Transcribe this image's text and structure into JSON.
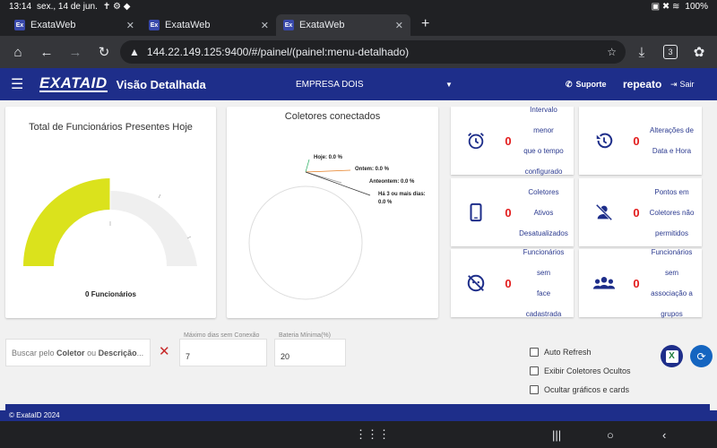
{
  "status_bar": {
    "time": "13:14",
    "date": "sex., 14 de jun.",
    "battery": "100%"
  },
  "browser": {
    "tabs": [
      {
        "label": "ExataWeb",
        "favicon": "Ex"
      },
      {
        "label": "ExataWeb",
        "favicon": "Ex"
      },
      {
        "label": "ExataWeb",
        "favicon": "Ex"
      }
    ],
    "url": "144.22.149.125:9400/#/painel/(painel:menu-detalhado)",
    "tab_count": "3"
  },
  "app": {
    "logo": "EXATAID",
    "title": "Visão Detalhada",
    "company": "EMPRESA DOIS",
    "support_label": "Suporte",
    "user": "repeato",
    "logout_label": "Sair"
  },
  "gauge_card": {
    "title": "Total de Funcionários Presentes Hoje",
    "label": "0 Funcionários",
    "fill_fraction": 0.5,
    "fill_color": "#dbe21c"
  },
  "collectors_card": {
    "title": "Coletores conectados",
    "labels": [
      "Hoje: 0.0 %",
      "Ontem: 0.0 %",
      "Anteontem: 0.0 %",
      "Há 3 ou mais dias:",
      "0.0 %"
    ]
  },
  "stats": [
    {
      "icon": "alarm-icon",
      "value": "0",
      "lines": [
        "Intervalo menor",
        "que o tempo",
        "configurado"
      ]
    },
    {
      "icon": "history-icon",
      "value": "0",
      "lines": [
        "Alterações de",
        "Data e Hora"
      ]
    },
    {
      "icon": "tablet-icon",
      "value": "0",
      "lines": [
        "Coletores Ativos",
        "Desatualizados"
      ]
    },
    {
      "icon": "person-off-icon",
      "value": "0",
      "lines": [
        "Pontos em",
        "Coletores não",
        "permitidos"
      ]
    },
    {
      "icon": "face-off-icon",
      "value": "0",
      "lines": [
        "Funcionários sem",
        "face cadastrada"
      ]
    },
    {
      "icon": "groups-icon",
      "value": "0",
      "lines": [
        "Funcionários sem",
        "associação a",
        "grupos"
      ]
    }
  ],
  "filters": {
    "search_prefix": "Buscar pelo ",
    "search_bold1": "Coletor",
    "search_mid": " ou ",
    "search_bold2": "Descrição",
    "search_suffix": "...",
    "max_days_label": "Máximo dias sem Conexão",
    "max_days_value": "7",
    "battery_label": "Bateria Mínima(%)",
    "battery_value": "20",
    "auto_refresh": "Auto Refresh",
    "show_hidden": "Exibir Coletores Ocultos",
    "hide_charts": "Ocultar gráficos e cards"
  },
  "footer": {
    "text": "© ExataID 2024"
  },
  "colors": {
    "primary": "#1e2e8a",
    "alert": "#e21b1b",
    "excel": "#1b7a3b",
    "refresh": "#1565c0"
  }
}
